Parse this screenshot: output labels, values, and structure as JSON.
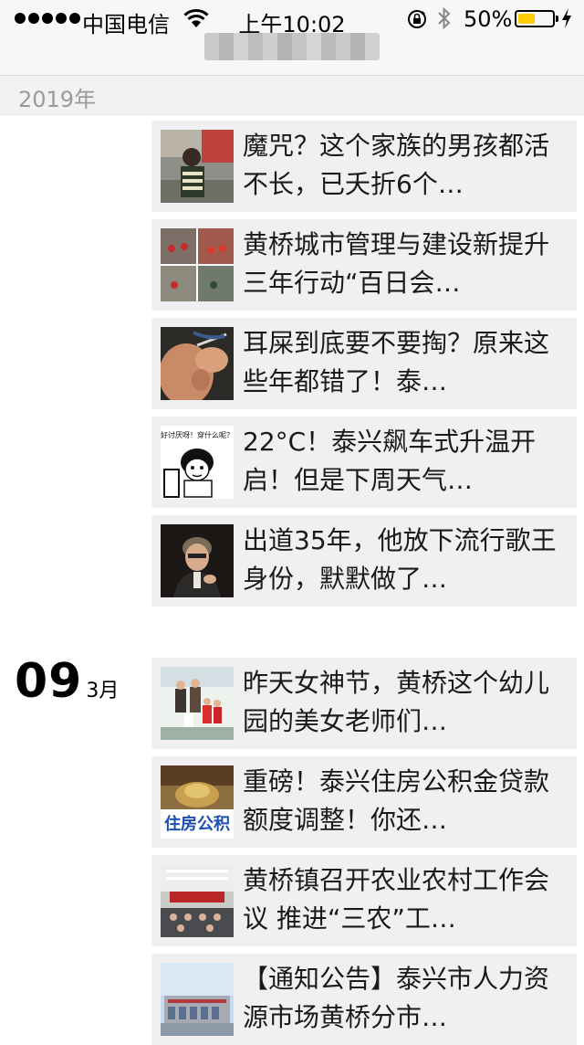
{
  "status_bar": {
    "carrier": "中国电信",
    "time": "上午10:02",
    "battery_percent": "50%",
    "battery_level": 0.5,
    "icons": [
      "signal-dots-icon",
      "wifi-icon",
      "rotation-lock-icon",
      "bluetooth-icon",
      "battery-icon",
      "charging-bolt-icon"
    ]
  },
  "section": {
    "year": "2019年"
  },
  "date_group": {
    "day": "09",
    "month": "3月"
  },
  "articles": [
    {
      "title": "魔咒？这个家族的男孩都活不长，已夭折6个…"
    },
    {
      "title": "黄桥城市管理与建设新提升三年行动“百日会…"
    },
    {
      "title": "耳屎到底要不要掏？原来这些年都错了！泰…"
    },
    {
      "title": "22°C！泰兴飙车式升温开启！但是下周天气…",
      "thumb_caption": "好讨厌呀！穿什么呢？"
    },
    {
      "title": "出道35年，他放下流行歌王身份，默默做了…"
    },
    {
      "title": "昨天女神节，黄桥这个幼儿园的美女老师们…"
    },
    {
      "title": "重磅！泰兴住房公积金贷款额度调整！你还…",
      "thumb_caption": "住房公积"
    },
    {
      "title": "黄桥镇召开农业农村工作会议 推进“三农”工…"
    },
    {
      "title": "【通知公告】泰兴市人力资源市场黄桥分市…"
    }
  ]
}
